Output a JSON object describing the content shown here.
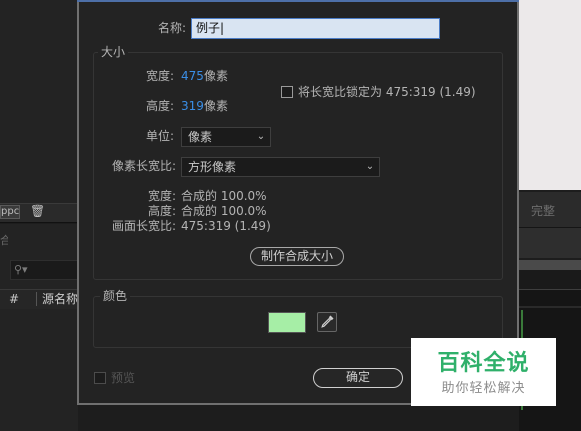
{
  "background_app": {
    "left_panel": {
      "tag_label": "ppc",
      "hint_char": "合",
      "columns": {
        "hash": "#",
        "source_name": "源名称"
      }
    },
    "right_panel": {
      "tab_label": "完整"
    }
  },
  "dialog": {
    "name_label": "名称:",
    "name_value": "例子",
    "size_group": {
      "legend": "大小",
      "width_label": "宽度:",
      "width_value": "475",
      "width_unit": "像素",
      "height_label": "高度:",
      "height_value": "319",
      "height_unit": "像素",
      "lock_ratio_label": "将长宽比锁定为 475:319 (1.49)",
      "lock_ratio_checked": false,
      "unit_label": "单位:",
      "unit_value": "像素",
      "pixel_aspect_label": "像素长宽比:",
      "pixel_aspect_value": "方形像素",
      "info_width_label": "宽度:",
      "info_width_value": "合成的 100.0%",
      "info_height_label": "高度:",
      "info_height_value": "合成的 100.0%",
      "frame_aspect_label": "画面长宽比:",
      "frame_aspect_value": "475:319 (1.49)",
      "make_comp_size_button": "制作合成大小"
    },
    "color_group": {
      "legend": "颜色",
      "swatch_color": "#a6eea6",
      "eyedropper_icon": "eyedropper-icon"
    },
    "preview_label": "预览",
    "preview_checked": false,
    "ok_button": "确定"
  },
  "watermark": {
    "title": "百科全说",
    "subtitle": "助你轻松解决"
  },
  "colors": {
    "accent_blue": "#3a8ee6",
    "dialog_bg": "#232323",
    "watermark_green": "#2fb06a"
  }
}
